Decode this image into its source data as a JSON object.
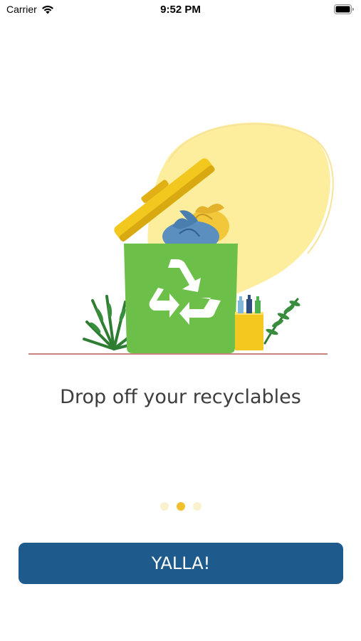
{
  "status_bar": {
    "carrier": "Carrier",
    "time": "9:52 PM"
  },
  "onboarding": {
    "illustration_icon": "recycling-bin-illustration",
    "caption": "Drop off your recyclables",
    "page_indicator": {
      "total": 3,
      "current": 2
    },
    "cta_label": "YALLA!"
  },
  "colors": {
    "primary": "#1e5a8b",
    "accent": "#f0c12d",
    "bin_green": "#6cc04a",
    "blob_yellow": "#fdee9e"
  }
}
